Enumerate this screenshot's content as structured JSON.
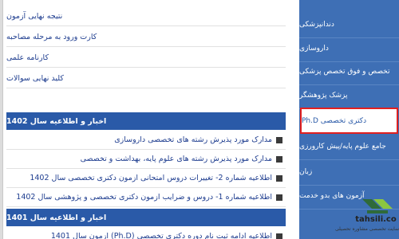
{
  "main": {
    "top_links": [
      "نتیجه نهایی آزمون",
      "کارت ورود به مرحله مصاحبه",
      "کارنامه علمی",
      "کلید نهایی سوالات"
    ],
    "section_1402": {
      "title": "اخبار و اطلاعیه سال 1402",
      "items": [
        "مدارک مورد پذیرش رشته های تخصصی داروسازی",
        "مدارک مورد پذیرش رشته های علوم پایه، بهداشت و تخصصی",
        "اطلاعیه شماره 2- تغییرات دروس امتحانی آزمون دکتری تخصصی سال 1402",
        "اطلاعیه شماره 1- دروس و ضرایب آزمون دکتری تخصصی و پژوهشی سال 1402"
      ]
    },
    "section_1401": {
      "title": "اخبار و اطلاعیه سال 1401",
      "items": [
        "اطلاعیه ادامه ثبت نام دوره دکتری تخصصی (Ph.D) آزمون سال 1401"
      ]
    }
  },
  "sidebar": {
    "items": [
      "دندانپزشکی",
      "داروسازی",
      "تخصص و فوق تخصص پزشکی",
      "پزشک پژوهشگر",
      "دکتری تخصصی Ph.D",
      "جامع علوم پایه/پیش کارورزی",
      "زبان",
      "آزمون های بدو خدمت"
    ],
    "active_index": 4
  },
  "watermark": {
    "brand": "tahsili.co",
    "tagline": "سایت تخصصی مشاوره تحصیلی"
  },
  "colors": {
    "sidebar_bg": "#3e6fb5",
    "section_header_bg": "#2a5aa8",
    "link_color": "#1e3d8f",
    "active_border": "#e02020"
  }
}
